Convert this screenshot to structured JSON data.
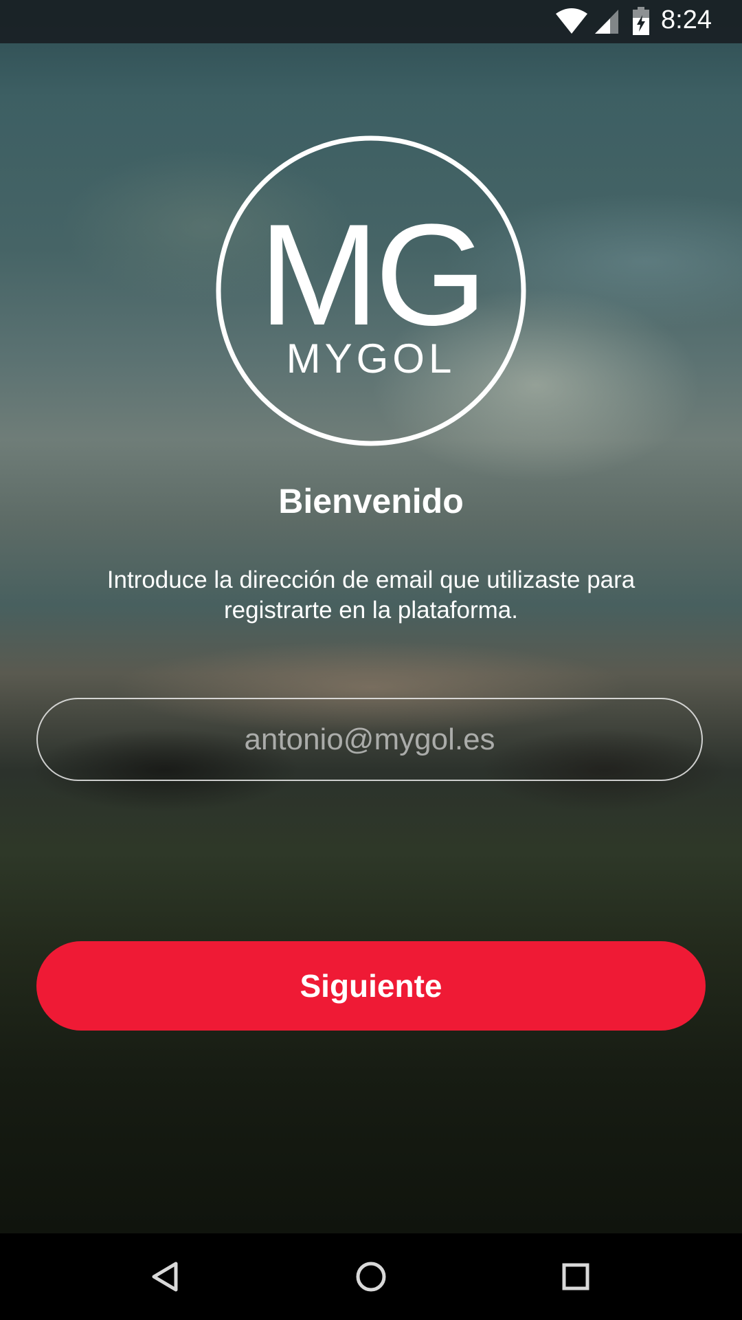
{
  "status_bar": {
    "time": "8:24",
    "icons": [
      "wifi-icon",
      "cell-signal-icon",
      "battery-charging-icon"
    ]
  },
  "logo": {
    "monogram": "MG",
    "wordmark": "MYGOL"
  },
  "welcome": {
    "title": "Bienvenido",
    "instructions": "Introduce la dirección de email que utilizaste para registrarte en la plataforma."
  },
  "email_field": {
    "placeholder": "antonio@mygol.es",
    "value": ""
  },
  "next_button": {
    "label": "Siguiente"
  },
  "nav_bar": {
    "icons": [
      "back-icon",
      "home-icon",
      "recents-icon"
    ]
  },
  "colors": {
    "accent": "#ef1a35",
    "text": "#ffffff"
  }
}
